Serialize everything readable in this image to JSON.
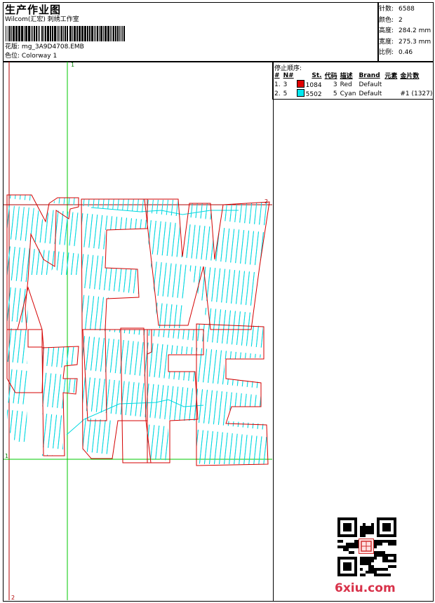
{
  "header": {
    "title": "生产作业图",
    "company": "Wilcom(汇宏) 刺绣工作室",
    "design_label": "花版:",
    "design_value": "mg_3A9D4708.EMB",
    "colorway_label": "色位:",
    "colorway_value": "Colorway 1"
  },
  "stats": [
    {
      "label": "针数:",
      "value": "6588"
    },
    {
      "label": "颜色:",
      "value": "2"
    },
    {
      "label": "高度:",
      "value": "284.2 mm"
    },
    {
      "label": "宽度:",
      "value": "275.3 mm"
    },
    {
      "label": "比例:",
      "value": "0.46"
    }
  ],
  "stop_sequence": {
    "title": "停止顺序:",
    "headers": [
      "#",
      "N#",
      "St.",
      "代码",
      "描述",
      "Brand",
      "元素",
      "金片数"
    ],
    "rows": [
      {
        "num": "1.",
        "needle": "3",
        "color": "#e00000",
        "stitches": "1084",
        "code": "3",
        "desc": "Red",
        "brand": "Default",
        "element": "",
        "sequins": ""
      },
      {
        "num": "2.",
        "needle": "5",
        "color": "#00e8f0",
        "stitches": "5502",
        "code": "5",
        "desc": "Cyan",
        "brand": "Default",
        "element": "",
        "sequins": "#1 (1327)"
      }
    ]
  },
  "guides": {
    "v1": "1",
    "v2": "2",
    "h2": "2",
    "h1": "1"
  },
  "watermark": "6xiu.com",
  "colors": {
    "red": "#d40000",
    "cyan": "#00d8e0",
    "green": "#00c800"
  }
}
